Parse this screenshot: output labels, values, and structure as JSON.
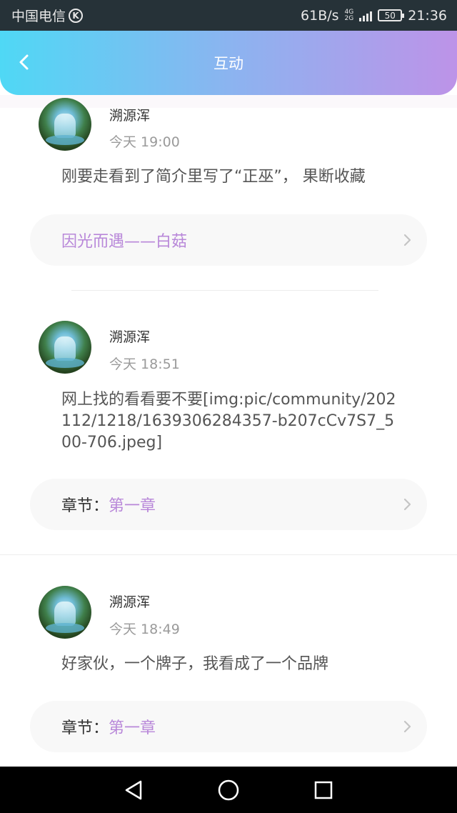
{
  "status_bar": {
    "carrier": "中国电信",
    "carrier_badge": "K",
    "network_speed": "61B/s",
    "network_type_top": "4G",
    "network_type_bottom": "2G",
    "battery": "50",
    "time": "21:36"
  },
  "header": {
    "title": "互动",
    "back_icon": "chevron-left-icon"
  },
  "comments": [
    {
      "username": "溯源浑",
      "time": "今天 19:00",
      "text": "刚要走看到了简介里写了“正巫”， 果断收藏",
      "link_prefix": "",
      "link_text": "因光而遇——白菇"
    },
    {
      "username": "溯源浑",
      "time": "今天 18:51",
      "text": "网上找的看看要不要[img:pic/community/202112/1218/1639306284357-b207cCv7S7_500-706.jpeg]",
      "link_prefix": "章节：",
      "link_text": "第一章"
    },
    {
      "username": "溯源浑",
      "time": "今天 18:49",
      "text": "好家伙，一个牌子，我看成了一个品牌",
      "link_prefix": "章节：",
      "link_text": "第一章"
    }
  ],
  "nav_bar": {
    "back_icon": "triangle-back-icon",
    "home_icon": "circle-home-icon",
    "recent_icon": "square-recent-icon"
  },
  "colors": {
    "header_gradient_start": "#4fd8f5",
    "header_gradient_end": "#bd93e8",
    "link_accent": "#b887d9"
  }
}
